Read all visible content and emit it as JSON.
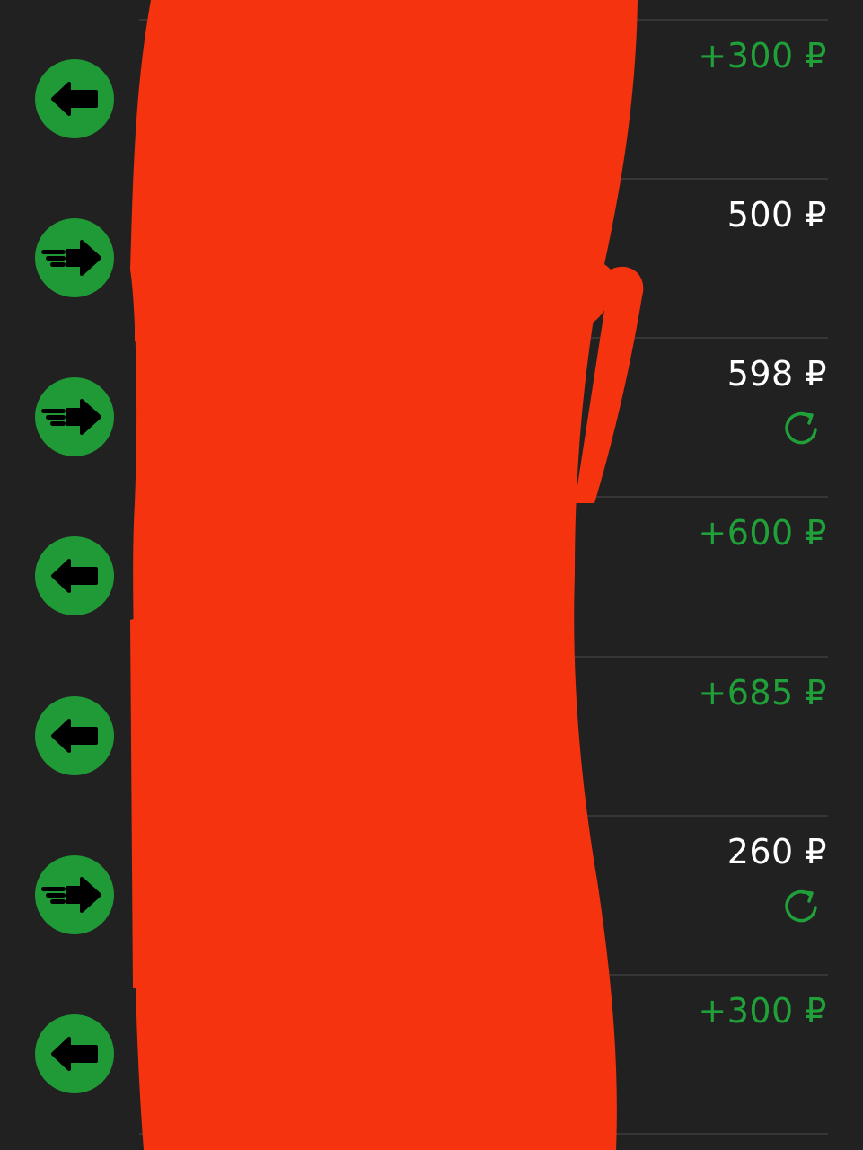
{
  "transactions": [
    {
      "direction": "incoming",
      "icon": "arrow-left-icon",
      "amount": "+300 ₽",
      "recurring": false
    },
    {
      "direction": "outgoing",
      "icon": "fast-arrow-right-icon",
      "amount": "500 ₽",
      "recurring": false
    },
    {
      "direction": "outgoing",
      "icon": "fast-arrow-right-icon",
      "amount": "598 ₽",
      "recurring": true
    },
    {
      "direction": "incoming",
      "icon": "arrow-left-icon",
      "amount": "+600 ₽",
      "recurring": false
    },
    {
      "direction": "incoming",
      "icon": "arrow-left-icon",
      "amount": "+685 ₽",
      "recurring": false
    },
    {
      "direction": "outgoing",
      "icon": "fast-arrow-right-icon",
      "amount": "260 ₽",
      "recurring": true
    },
    {
      "direction": "incoming",
      "icon": "arrow-left-icon",
      "amount": "+300 ₽",
      "recurring": false
    }
  ],
  "colors": {
    "background": "#212121",
    "accent_green": "#1f9a37",
    "income_text": "#20a038",
    "expense_text": "#ffffff",
    "divider": "#363636",
    "redaction": "#f5330f"
  }
}
